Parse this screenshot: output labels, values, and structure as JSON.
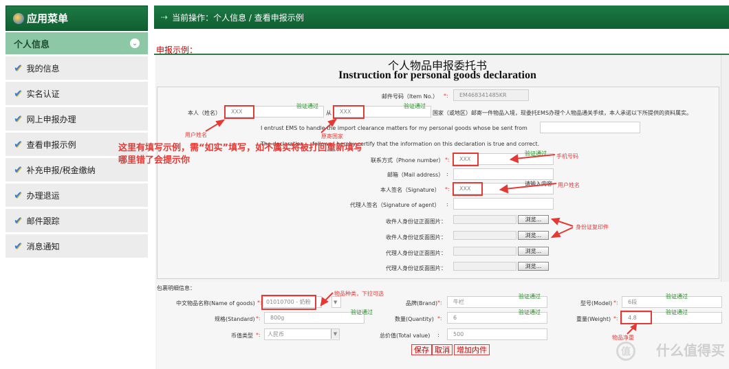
{
  "sidebar": {
    "header": "应用菜单",
    "section": "个人信息",
    "items": [
      {
        "label": "我的信息"
      },
      {
        "label": "实名认证"
      },
      {
        "label": "网上申报办理"
      },
      {
        "label": "查看申报示例"
      },
      {
        "label": "补充申报/税金缴纳"
      },
      {
        "label": "办理退运"
      },
      {
        "label": "邮件跟踪"
      },
      {
        "label": "消息通知"
      }
    ]
  },
  "topbar": {
    "breadcrumb": "当前操作：个人信息 / 查看申报示例"
  },
  "content": {
    "subtitle": "申报示例：",
    "title_cn": "个人物品申报委托书",
    "title_en": "Instruction for personal goods declaration",
    "item_no_label": "邮件号码（Item No.）",
    "item_no_value": "EM468341485KR",
    "name_label": "本人（姓名）",
    "name_value": "XXX",
    "from_label": "从",
    "from_value": "XXX",
    "country_text": "国家（或地区）邮寄一件物品入境，现委托EMS办理个人物品通关手续，本人承诺以下所提供的资料属实。",
    "entrust_text": "I entrust EMS to handle the import clearance matters for my personal goods whose be sent from",
    "certify_text": "The declaration ... follows.I hereby certify that the information on this declaration is true and correct.",
    "phone_label": "联系方式（Phone number）",
    "phone_value": "XXX",
    "mail_label": "邮箱（Mail address）",
    "sign_label": "本人签名（Signature）",
    "sign_value": "XXX",
    "agent_label": "代理人签名（Signature of agent）",
    "id_front_label": "收件人身份证正面图片：",
    "id_back_label": "收件人身份证反面图片：",
    "agent_front_label": "代理人身份证正面图片：",
    "agent_back_label": "代理人身份证反面图片：",
    "browse": "浏览...",
    "parcel_label": "包裹明细信息：",
    "goods_name_label": "中文物品名称(Name of goods)",
    "goods_name_value": "01010700 - 奶粉",
    "brand_label": "品牌(Brand)",
    "brand_value": "牛栏",
    "model_label": "型号(Model)",
    "model_value": "6段",
    "standard_label": "规格(Standard)",
    "standard_value": "800g",
    "quantity_label": "数量(Quantity)",
    "quantity_value": "6",
    "weight_label": "重量(Weight)",
    "weight_value": "4.8",
    "currency_label": "币值类型",
    "currency_value": "人民币",
    "total_label": "总价值(Total value)",
    "total_value": "500",
    "btn_save": "保存",
    "btn_cancel": "取消",
    "btn_add": "增加内件",
    "ok": "验证通过",
    "note_user_name": "用户姓名",
    "note_origin": "原寄国家",
    "note_phone": "手机号码",
    "note_input": "请输入内容",
    "note_id_print": "身份证复印件",
    "note_goods": "物品种类，下拉可选",
    "note_weight": "物品净重",
    "big_note_1": "这里有填写示例，需“如实”填写，如不属实将被打回重新填写",
    "big_note_2": "哪里错了会提示你",
    "watermark": "什么值得买",
    "watermark_logo": "值"
  },
  "colors": {
    "accent": "#1d7a45",
    "annotation": "#e53935",
    "valid": "#1e8e1e"
  }
}
